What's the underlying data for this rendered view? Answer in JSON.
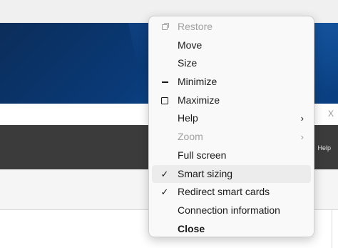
{
  "background": {
    "toolbar_help_label": "Help",
    "close_glyph": "X"
  },
  "menu": {
    "items": [
      {
        "label": "Restore",
        "icon": "restore-icon",
        "disabled": true
      },
      {
        "label": "Move"
      },
      {
        "label": "Size"
      },
      {
        "label": "Minimize",
        "icon": "minimize-icon"
      },
      {
        "label": "Maximize",
        "icon": "maximize-icon"
      },
      {
        "label": "Help",
        "submenu": true
      },
      {
        "label": "Zoom",
        "submenu": true,
        "disabled": true
      },
      {
        "label": "Full screen"
      },
      {
        "label": "Smart sizing",
        "checked": true,
        "highlighted": true
      },
      {
        "label": "Redirect smart cards",
        "checked": true
      },
      {
        "label": "Connection information"
      },
      {
        "label": "Close",
        "bold": true
      }
    ],
    "check_glyph": "✓",
    "chevron_glyph": "›"
  },
  "colors": {
    "desktop_blue": "#0a3a78",
    "toolbar_dark": "#3b3b3b",
    "menu_bg": "#f9f9f9",
    "highlight": "#ececec",
    "disabled_text": "#a0a0a0"
  }
}
